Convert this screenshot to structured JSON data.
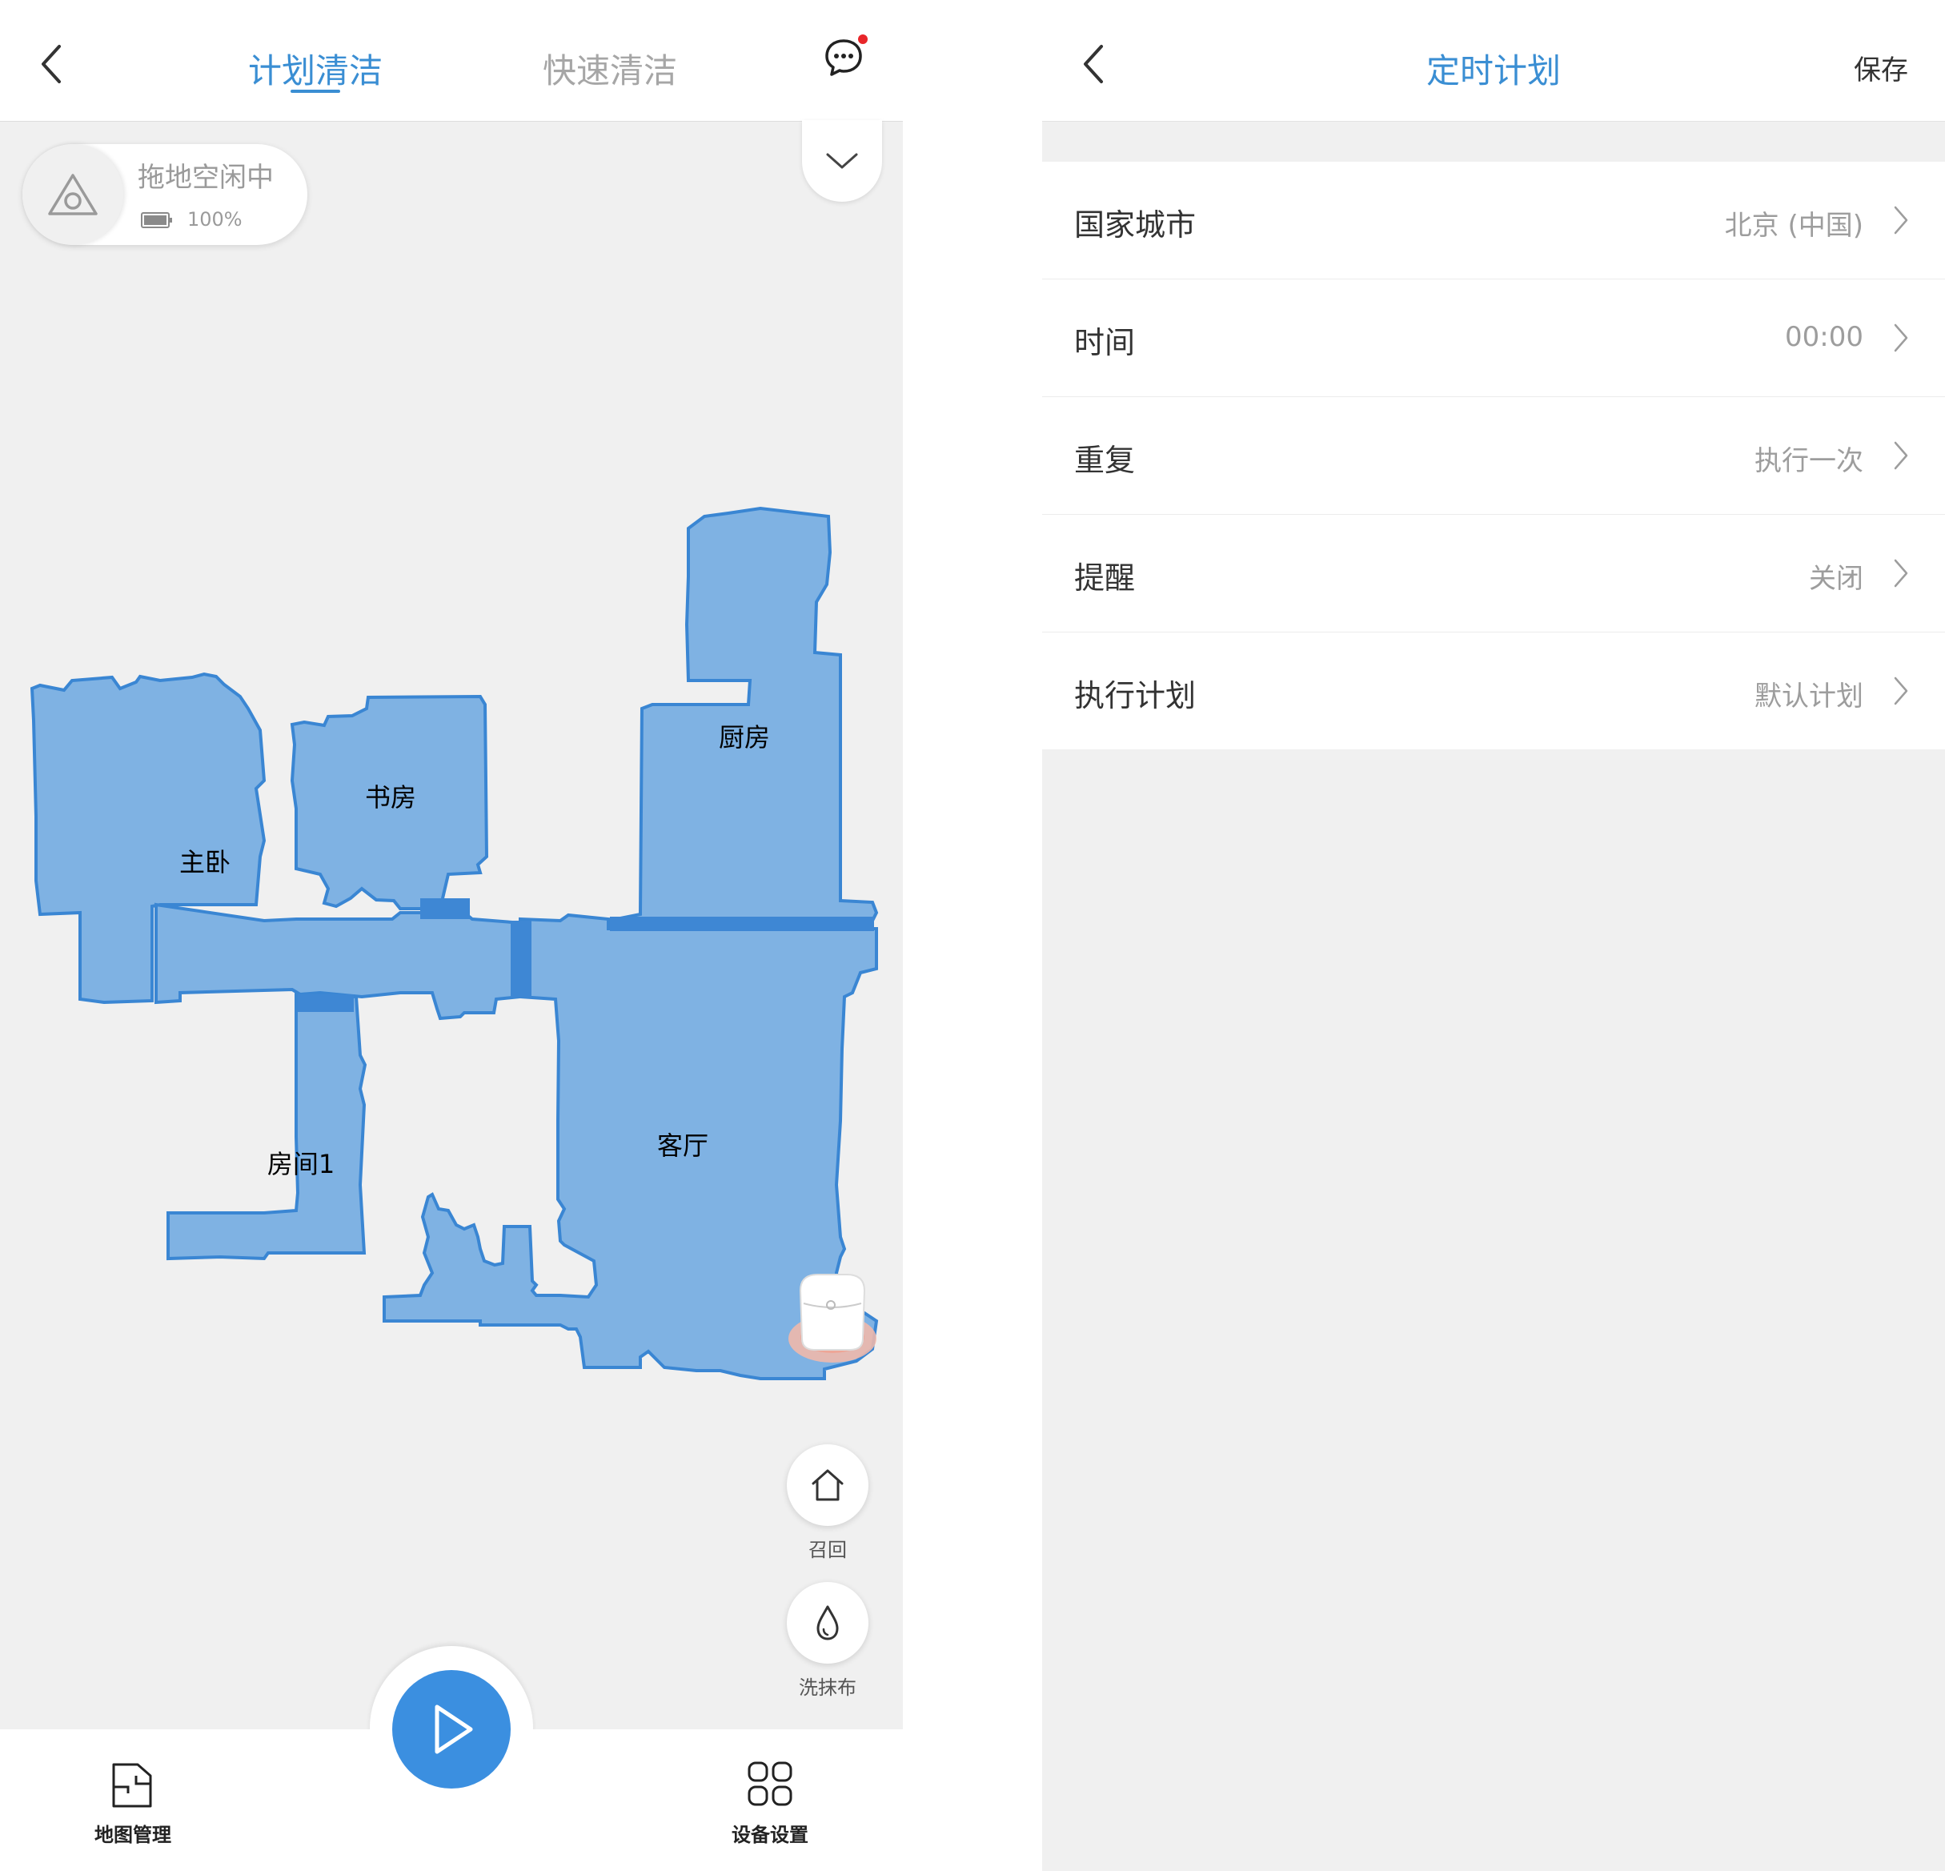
{
  "left": {
    "tabs": [
      {
        "label": "计划清洁",
        "active": true
      },
      {
        "label": "快速清洁",
        "active": false
      }
    ],
    "status": {
      "text": "拖地空闲中",
      "battery": "100%"
    },
    "rooms": [
      "主卧",
      "书房",
      "厨房",
      "房间1",
      "客厅"
    ],
    "side_buttons": {
      "recall": "召回",
      "wash": "洗抹布"
    },
    "bottom_nav": {
      "map_management": "地图管理",
      "device_settings": "设备设置"
    }
  },
  "right": {
    "title": "定时计划",
    "save": "保存",
    "settings": [
      {
        "label": "国家城市",
        "value": "北京 (中国)"
      },
      {
        "label": "时间",
        "value": "00:00"
      },
      {
        "label": "重复",
        "value": "执行一次"
      },
      {
        "label": "提醒",
        "value": "关闭"
      },
      {
        "label": "执行计划",
        "value": "默认计划"
      }
    ]
  },
  "colors": {
    "accent": "#3a8ed3",
    "map_fill": "#7fb2e3",
    "map_edge": "#3a86d3",
    "start_button": "#3b8fe0",
    "notification_dot": "#e8262a"
  }
}
